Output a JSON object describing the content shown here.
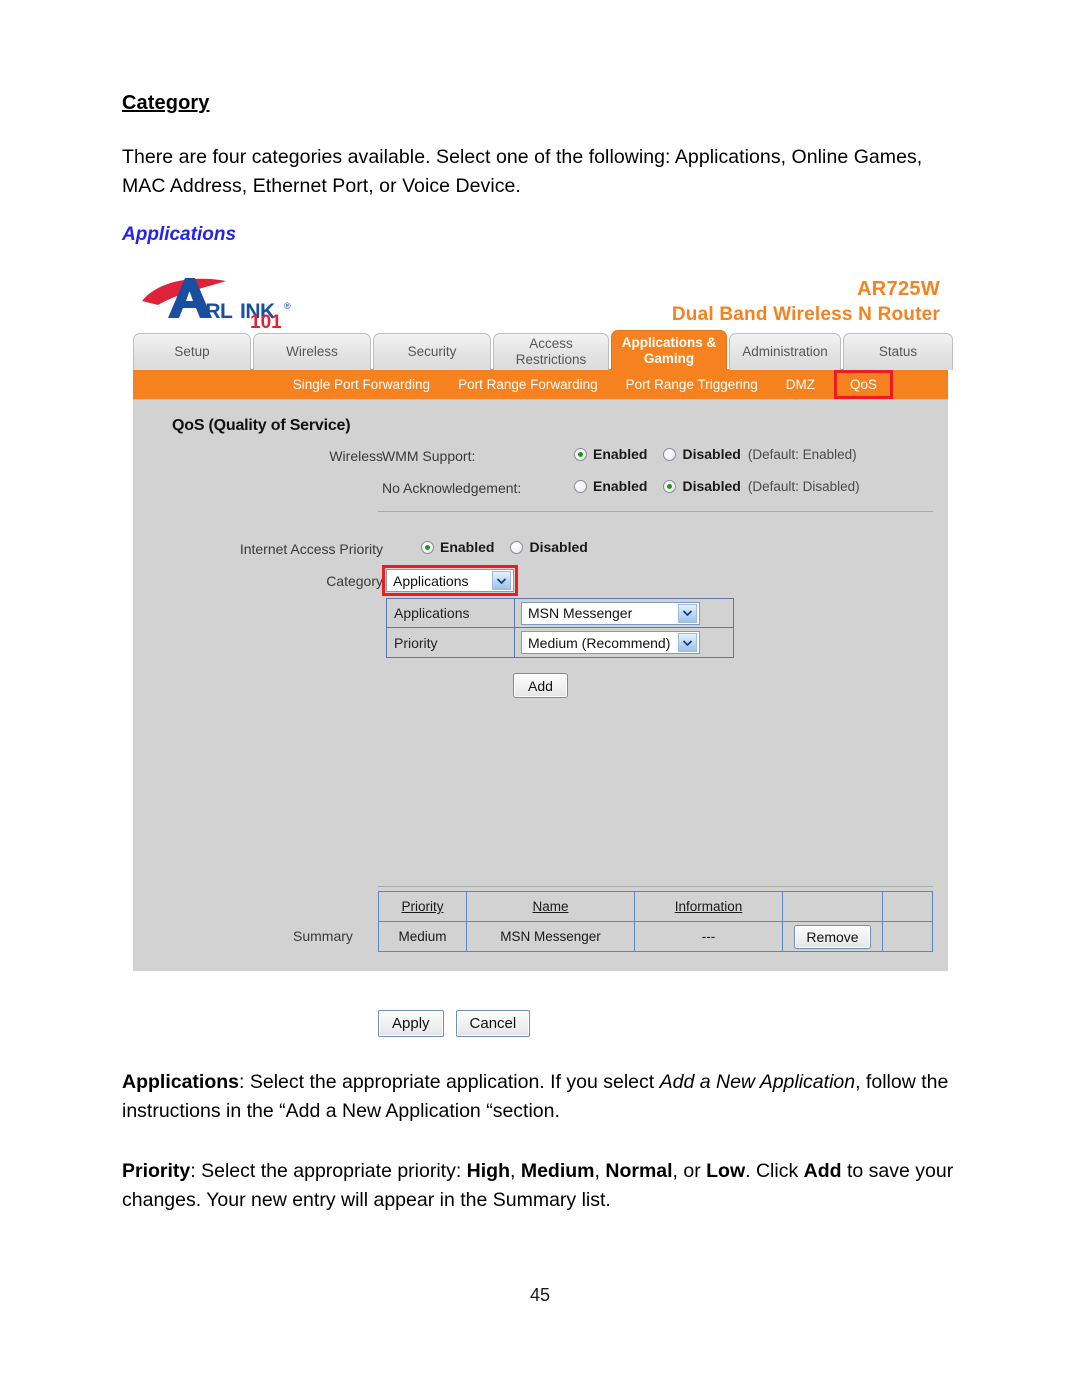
{
  "document": {
    "heading": "Category",
    "intro": "There are four categories available. Select one of the following: Applications, Online Games, MAC Address, Ethernet Port, or Voice Device.",
    "subheading": "Applications",
    "page_number": "45",
    "notes": {
      "applications": {
        "term": "Applications",
        "part1": ": Select the appropriate application. If you select ",
        "italic": "Add a New Application",
        "part2": ", follow the instructions in the “Add a New Application “section."
      },
      "priority": {
        "term": "Priority",
        "part1": ": Select the appropriate priority: ",
        "b1": "High",
        "sep1": ", ",
        "b2": "Medium",
        "sep2": ", ",
        "b3": "Normal",
        "sep3": ", or ",
        "b4": "Low",
        "sep4": ". Click ",
        "b5": "Add",
        "part2": " to save your changes. Your new entry will appear in the Summary list."
      }
    }
  },
  "router": {
    "brand": {
      "name": "AirLink",
      "suffix": "101",
      "registered": "®"
    },
    "model": "AR725W",
    "model_desc": "Dual Band Wireless N Router",
    "tabs": [
      {
        "label": "Setup",
        "active": false
      },
      {
        "label": "Wireless",
        "active": false
      },
      {
        "label": "Security",
        "active": false
      },
      {
        "label": "Access Restrictions",
        "active": false
      },
      {
        "label": "Applications & Gaming",
        "active": true
      },
      {
        "label": "Administration",
        "active": false
      },
      {
        "label": "Status",
        "active": false
      }
    ],
    "subnav": [
      {
        "label": "Single Port Forwarding",
        "selected": false
      },
      {
        "label": "Port Range Forwarding",
        "selected": false
      },
      {
        "label": "Port Range Triggering",
        "selected": false
      },
      {
        "label": "DMZ",
        "selected": false
      },
      {
        "label": "QoS",
        "selected": true
      }
    ],
    "panel": {
      "title": "QoS (Quality of Service)",
      "wireless_label": "Wireless",
      "wmm": {
        "label": "WMM Support:",
        "enabled_label": "Enabled",
        "disabled_label": "Disabled",
        "selected": "Enabled",
        "default_note": "(Default: Enabled)"
      },
      "no_ack": {
        "label": "No Acknowledgement:",
        "enabled_label": "Enabled",
        "disabled_label": "Disabled",
        "selected": "Disabled",
        "default_note": "(Default: Disabled)"
      },
      "internet_access_priority": {
        "label": "Internet Access Priority",
        "enabled_label": "Enabled",
        "disabled_label": "Disabled",
        "selected": "Enabled"
      },
      "category": {
        "label": "Category",
        "value": "Applications"
      },
      "applications_row": {
        "label": "Applications",
        "value": "MSN Messenger"
      },
      "priority_row": {
        "label": "Priority",
        "value": "Medium (Recommend)"
      },
      "add_button": "Add",
      "summary": {
        "label": "Summary",
        "columns": [
          "Priority",
          "Name",
          "Information",
          "",
          ""
        ],
        "rows": [
          {
            "priority": "Medium",
            "name": "MSN Messenger",
            "information": "---",
            "action": "Remove",
            "blank": ""
          }
        ]
      }
    },
    "footer": {
      "apply": "Apply",
      "cancel": "Cancel"
    },
    "accent_orange": "#F5821F",
    "highlight_red": "#EE1C1C",
    "panel_grey": "#D2D2D2"
  }
}
